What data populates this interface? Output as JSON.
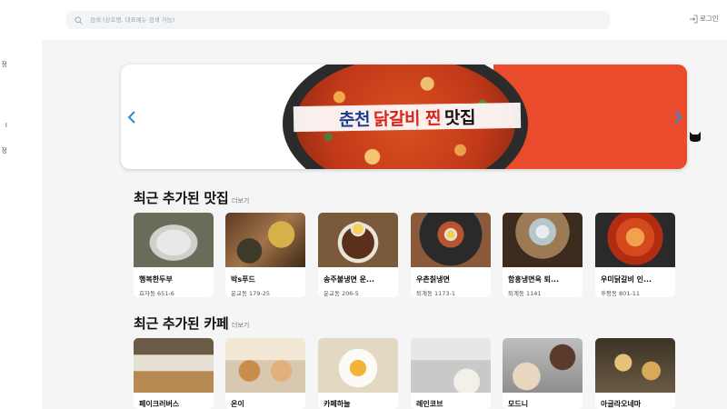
{
  "header": {
    "search_placeholder": "검색 (상호명, 대표메뉴 검색 가능)",
    "login_label": "로그인"
  },
  "sidebar": {
    "items": [
      "정",
      "I",
      "정"
    ]
  },
  "banner": {
    "title_part1": "춘천",
    "title_part2": "닭갈비 찐",
    "title_part3": "맛집",
    "accent_color": "#ea4b2c",
    "arrow_color": "#1f8fd6"
  },
  "restaurants": {
    "title": "최근 추가된 맛집",
    "more_label": "더보기",
    "items": [
      {
        "name": "행복한두부",
        "address": "효자동 651-6"
      },
      {
        "name": "박s푸드",
        "address": "운교동 179-25"
      },
      {
        "name": "송주불냉면 운...",
        "address": "운교동 206-5"
      },
      {
        "name": "우촌칡냉면",
        "address": "퇴계동 1173-1"
      },
      {
        "name": "함흥냉면옥 퇴...",
        "address": "퇴계동 1141"
      },
      {
        "name": "우미닭갈비 인...",
        "address": "후평동 801-11"
      }
    ]
  },
  "cafes": {
    "title": "최근 추가된 카페",
    "more_label": "더보기",
    "items": [
      {
        "name": "페이크러버스"
      },
      {
        "name": "온이"
      },
      {
        "name": "카페하늘"
      },
      {
        "name": "레인코브"
      },
      {
        "name": "모드니"
      },
      {
        "name": "아글라오네마"
      }
    ]
  }
}
